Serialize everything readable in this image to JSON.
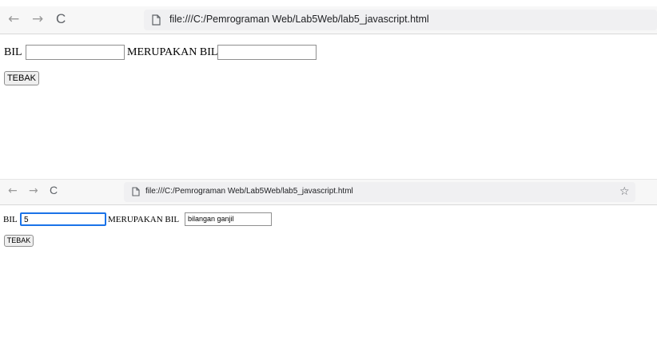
{
  "top": {
    "nav": {
      "back": "←",
      "forward": "→",
      "reload": "C"
    },
    "url": "file:///C:/Pemrograman Web/Lab5Web/lab5_javascript.html",
    "label_bil": "BIL",
    "label_merupakan": "MERUPAKAN BIL",
    "input_bil_value": "",
    "input_result_value": "",
    "button_label": "TEBAK"
  },
  "bottom": {
    "nav": {
      "back": "←",
      "forward": "→",
      "reload": "C"
    },
    "url": "file:///C:/Pemrograman Web/Lab5Web/lab5_javascript.html",
    "bookmark": "☆",
    "label_bil": "BIL",
    "label_merupakan": "MERUPAKAN BIL",
    "input_bil_value": "5",
    "input_result_value": "bilangan ganjil",
    "button_label": "TEBAK"
  }
}
